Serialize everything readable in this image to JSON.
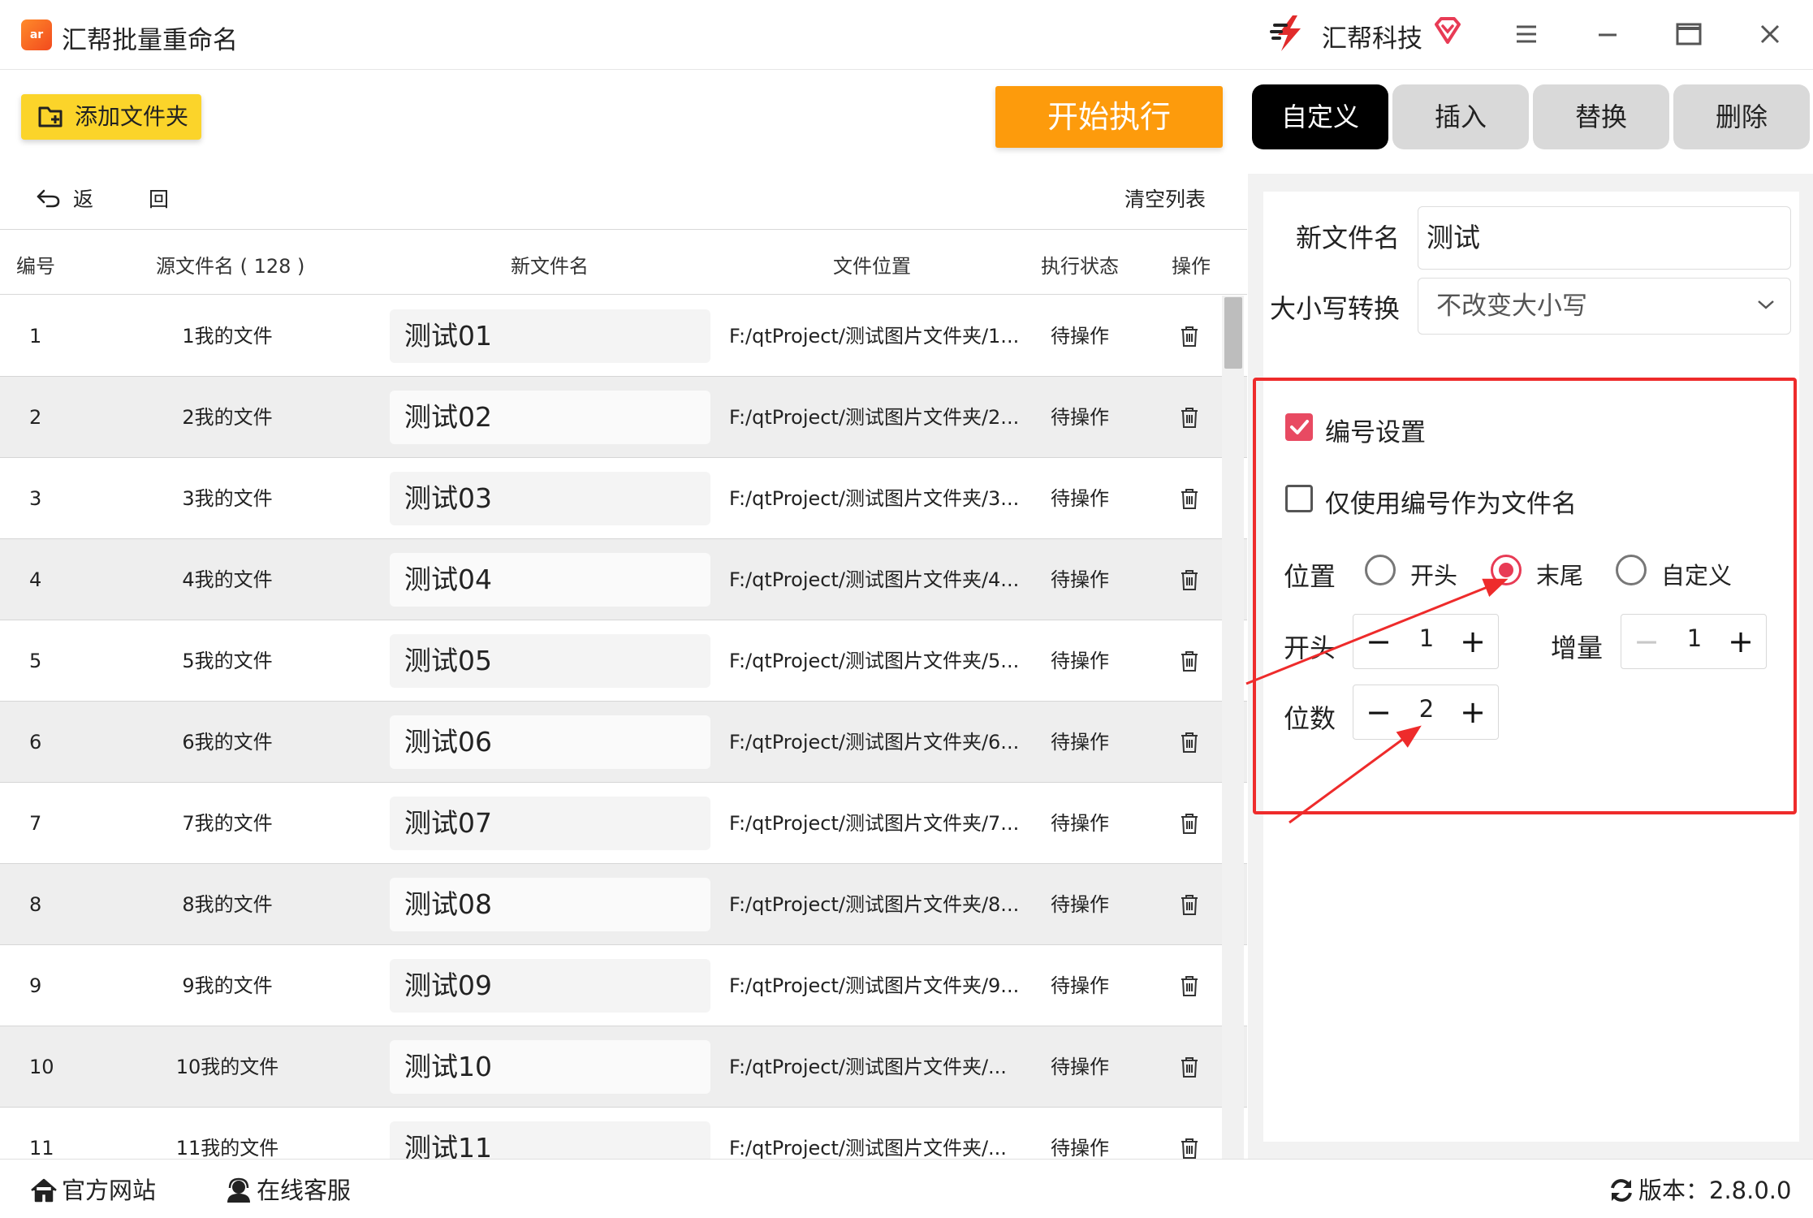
{
  "app": {
    "icon_text": "ar",
    "title": "汇帮批量重命名"
  },
  "brand": {
    "name": "汇帮科技",
    "logo_icon": "brand-logo-icon",
    "vip_icon": "diamond-vip-icon"
  },
  "window_controls": {
    "menu": "menu-icon",
    "minimize": "minimize-icon",
    "maximize": "maximize-icon",
    "close": "close-icon"
  },
  "toolbar": {
    "add_folder": "添加文件夹",
    "start": "开始执行"
  },
  "tabs": [
    {
      "label": "自定义",
      "active": true
    },
    {
      "label": "插入",
      "active": false
    },
    {
      "label": "替换",
      "active": false
    },
    {
      "label": "删除",
      "active": false
    }
  ],
  "list": {
    "back": "返 回",
    "clear": "清空列表",
    "headers": {
      "num": "编号",
      "src": "源文件名 ( 128 )",
      "new": "新文件名",
      "path": "文件位置",
      "status": "执行状态",
      "op": "操作"
    },
    "rows": [
      {
        "num": "1",
        "src": "1我的文件",
        "new": "测试01",
        "path": "F:/qtProject/测试图片文件夹/1...",
        "status": "待操作"
      },
      {
        "num": "2",
        "src": "2我的文件",
        "new": "测试02",
        "path": "F:/qtProject/测试图片文件夹/2...",
        "status": "待操作"
      },
      {
        "num": "3",
        "src": "3我的文件",
        "new": "测试03",
        "path": "F:/qtProject/测试图片文件夹/3...",
        "status": "待操作"
      },
      {
        "num": "4",
        "src": "4我的文件",
        "new": "测试04",
        "path": "F:/qtProject/测试图片文件夹/4...",
        "status": "待操作"
      },
      {
        "num": "5",
        "src": "5我的文件",
        "new": "测试05",
        "path": "F:/qtProject/测试图片文件夹/5...",
        "status": "待操作"
      },
      {
        "num": "6",
        "src": "6我的文件",
        "new": "测试06",
        "path": "F:/qtProject/测试图片文件夹/6...",
        "status": "待操作"
      },
      {
        "num": "7",
        "src": "7我的文件",
        "new": "测试07",
        "path": "F:/qtProject/测试图片文件夹/7...",
        "status": "待操作"
      },
      {
        "num": "8",
        "src": "8我的文件",
        "new": "测试08",
        "path": "F:/qtProject/测试图片文件夹/8...",
        "status": "待操作"
      },
      {
        "num": "9",
        "src": "9我的文件",
        "new": "测试09",
        "path": "F:/qtProject/测试图片文件夹/9...",
        "status": "待操作"
      },
      {
        "num": "10",
        "src": "10我的文件",
        "new": "测试10",
        "path": "F:/qtProject/测试图片文件夹/...",
        "status": "待操作"
      },
      {
        "num": "11",
        "src": "11我的文件",
        "new": "测试11",
        "path": "F:/qtProject/测试图片文件夹/...",
        "status": "待操作"
      }
    ]
  },
  "panel": {
    "new_name_label": "新文件名",
    "new_name_value": "测试",
    "case_label": "大小写转换",
    "case_value": "不改变大小写",
    "numbering_label": "编号设置",
    "numbering_checked": true,
    "only_number_label": "仅使用编号作为文件名",
    "only_number_checked": false,
    "position_label": "位置",
    "position_options": [
      "开头",
      "末尾",
      "自定义"
    ],
    "position_selected": "末尾",
    "start_label": "开头",
    "start_value": "1",
    "increment_label": "增量",
    "increment_value": "1",
    "digits_label": "位数",
    "digits_value": "2",
    "minus": "−",
    "plus": "+"
  },
  "bottom": {
    "website": "官方网站",
    "support": "在线客服",
    "version": "版本：2.8.0.0"
  },
  "colors": {
    "accent_orange": "#fd9b0c",
    "folder_yellow": "#fbd42a",
    "check_pink": "#e84a62",
    "annotation_red": "#ee2b2b"
  }
}
